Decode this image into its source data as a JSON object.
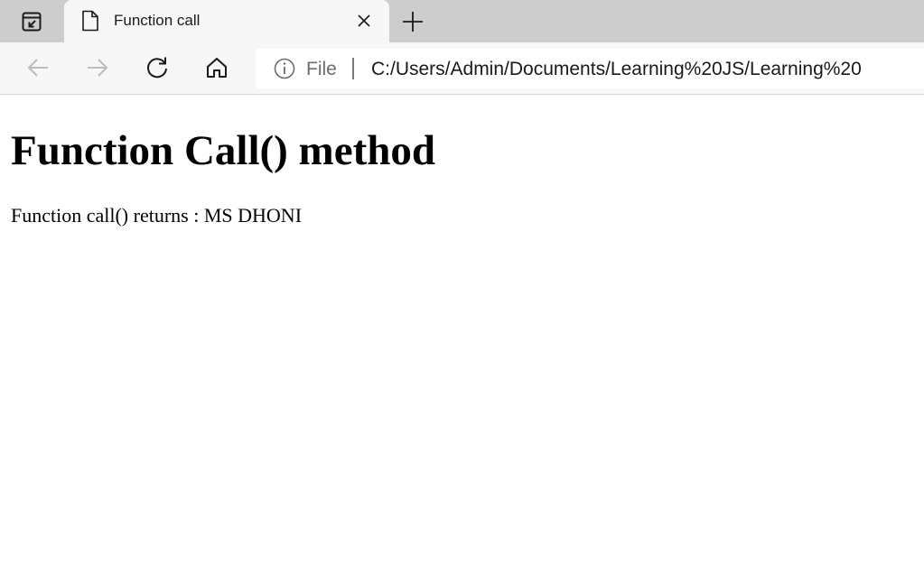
{
  "tab": {
    "title": "Function call"
  },
  "address_bar": {
    "scheme_label": "File",
    "url": "C:/Users/Admin/Documents/Learning%20JS/Learning%20"
  },
  "page": {
    "heading": "Function Call() method",
    "output_label": "Function call() returns : ",
    "output_value": "MS DHONI"
  },
  "icons": {
    "tab_actions": "tab-actions-icon",
    "favicon": "document-icon",
    "close": "close-icon",
    "new_tab": "plus-icon",
    "back": "back-arrow-icon",
    "forward": "forward-arrow-icon",
    "refresh": "refresh-icon",
    "home": "home-icon",
    "site_info": "info-icon"
  }
}
